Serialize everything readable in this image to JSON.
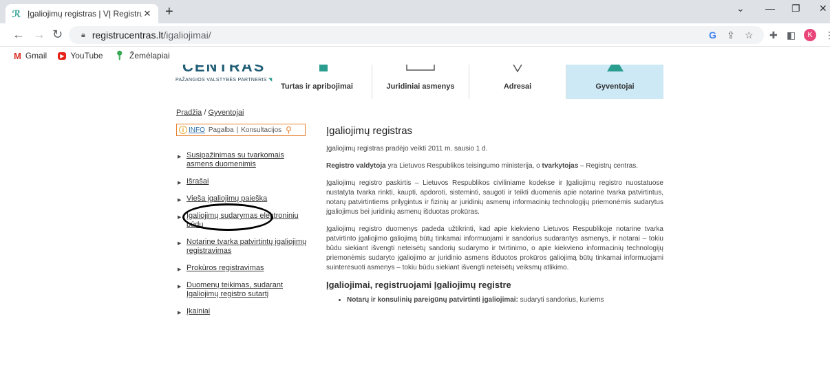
{
  "browser": {
    "tab_title": "Įgaliojimų registras | VĮ Registrų c",
    "new_tab": "+",
    "url_host": "registrucentras.lt",
    "url_path": "/igaliojimai/",
    "avatar_letter": "K",
    "bookmarks": [
      {
        "label": "Gmail",
        "icon": "gmail-icon"
      },
      {
        "label": "YouTube",
        "icon": "youtube-icon"
      },
      {
        "label": "Žemėlapiai",
        "icon": "maps-icon"
      }
    ]
  },
  "logo": {
    "big": "CENTRAS",
    "sub": "PAŽANGIOS VALSTYBĖS PARTNERIS"
  },
  "main_nav": [
    {
      "label": "Turtas ir apribojimai"
    },
    {
      "label": "Juridiniai asmenys"
    },
    {
      "label": "Adresai"
    },
    {
      "label": "Gyventojai"
    }
  ],
  "breadcrumb": {
    "home": "Pradžia",
    "sep": "/",
    "current": "Gyventojai"
  },
  "search": {
    "info": "INFO",
    "help": "Pagalba",
    "sep": "|",
    "consult": "Konsultacijos"
  },
  "sidebar": [
    {
      "label": "Susipažinimas su tvarkomais asmens duomenimis"
    },
    {
      "label": "Išrašai"
    },
    {
      "label": "Vieša įgaliojimų paieška"
    },
    {
      "label": "Įgaliojimų sudarymas elektroniniu būdu"
    },
    {
      "label": "Notarine tvarka patvirtintų įgaliojimų registravimas"
    },
    {
      "label": "Prokūros registravimas"
    },
    {
      "label": "Duomenų teikimas, sudarant Įgaliojimų registro sutartį"
    },
    {
      "label": "Įkainiai"
    }
  ],
  "content": {
    "title": "Įgaliojimų registras",
    "p1": "Įgaliojimų registras pradėjo veikti 2011 m. sausio 1 d.",
    "p2_bold1": "Registro valdytoja",
    "p2_mid": " yra Lietuvos Respublikos teisingumo ministerija, o ",
    "p2_bold2": "tvarkytojas",
    "p2_end": " – Registrų centras.",
    "p3": "Įgaliojimų registro paskirtis – Lietuvos Respublikos civiliniame kodekse ir Įgaliojimų registro nuostatuose nustatyta tvarka rinkti, kaupti, apdoroti, sisteminti, saugoti ir teikti duomenis apie notarine tvarka patvirtintus, notarų patvirtintiems prilygintus ir fizinių ar juridinių asmenų informacinių technologijų priemonėmis sudarytus įgaliojimus bei juridinių asmenų išduotas prokūras.",
    "p4": "Įgaliojimų registro duomenys padeda užtikrinti, kad apie kiekvieno Lietuvos Respublikoje notarine tvarka patvirtinto įgaliojimo galiojimą būtų tinkamai informuojami ir sandorius sudarantys asmenys, ir notarai – tokiu būdu siekiant išvengti neteisėtų sandorių sudarymo ir tvirtinimo, o apie kiekvieno informacinių technologijų priemonėmis sudaryto įgaliojimo ar juridinio asmens išduotos prokūros  galiojimą būtų tinkamai informuojami suinteresuoti  asmenys – tokiu būdu siekiant išvengti neteisėtų veiksmų atlikimo.",
    "h2": "Įgaliojimai, registruojami Įgaliojimų registre",
    "li1_bold": "Notarų ir konsulinių pareigūnų patvirtinti įgaliojimai:",
    "li1_text": " sudaryti sandorius, kuriems"
  }
}
